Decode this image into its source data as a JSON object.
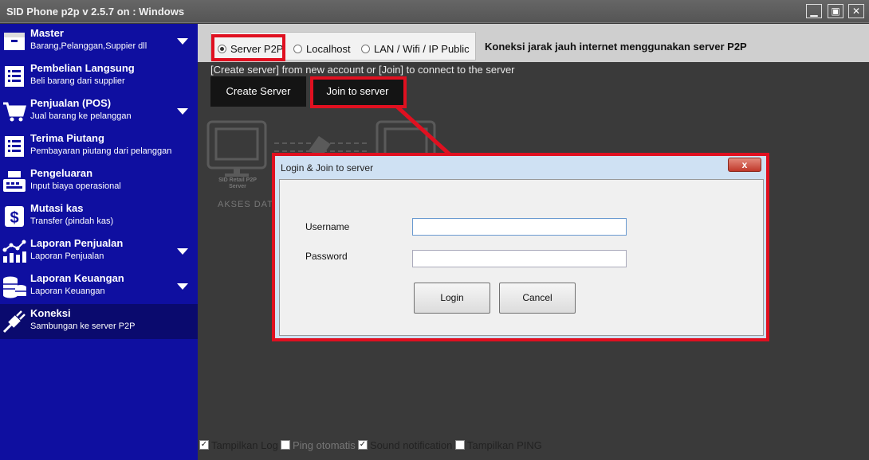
{
  "window": {
    "title": "SID Phone p2p v 2.5.7 on : Windows",
    "min_glyph": "▁",
    "max_glyph": "▣",
    "close_glyph": "✕"
  },
  "sidebar": {
    "items": [
      {
        "title": "Master",
        "subtitle": "Barang,Pelanggan,Suppier dll",
        "icon": "box-icon",
        "expandable": true
      },
      {
        "title": "Pembelian Langsung",
        "subtitle": "Beli barang dari supplier",
        "icon": "list-icon",
        "expandable": false
      },
      {
        "title": "Penjualan (POS)",
        "subtitle": "Jual barang ke pelanggan",
        "icon": "cart-icon",
        "expandable": true
      },
      {
        "title": "Terima Piutang",
        "subtitle": "Pembayaran piutang dari pelanggan",
        "icon": "list-icon",
        "expandable": false
      },
      {
        "title": "Pengeluaran",
        "subtitle": "Input biaya operasional",
        "icon": "cash-register-icon",
        "expandable": false
      },
      {
        "title": "Mutasi kas",
        "subtitle": "Transfer (pindah kas)",
        "icon": "dollar-icon",
        "expandable": false
      },
      {
        "title": "Laporan Penjualan",
        "subtitle": "Laporan Penjualan",
        "icon": "chart-icon",
        "expandable": true
      },
      {
        "title": "Laporan Keuangan",
        "subtitle": "Laporan Keuangan",
        "icon": "coins-icon",
        "expandable": true
      },
      {
        "title": "Koneksi",
        "subtitle": "Sambungan ke server P2P",
        "icon": "plug-icon",
        "expandable": false,
        "active": true
      }
    ]
  },
  "connection": {
    "options": [
      "Server P2P",
      "Localhost",
      "LAN / Wifi / IP Public"
    ],
    "selected": "Server P2P",
    "description": "Koneksi jarak jauh internet menggunakan server P2P",
    "instruction": "[Create server] from new account or [Join] to connect to the server",
    "create_label": "Create Server",
    "join_label": "Join to server"
  },
  "diagram": {
    "server_caption_1": "SID Retail P2P",
    "server_caption_2": "Server",
    "akses_label": "AKSES DATA"
  },
  "dialog": {
    "title": "Login & Join to server",
    "close_glyph": "x",
    "username_label": "Username",
    "username_value": "",
    "password_label": "Password",
    "password_value": "",
    "login_label": "Login",
    "cancel_label": "Cancel"
  },
  "footer": {
    "checks": [
      {
        "label": "Tampilkan Log",
        "checked": true
      },
      {
        "label": "Ping otomatis",
        "checked": false
      },
      {
        "label": "Sound notification",
        "checked": true
      },
      {
        "label": "Tampilkan PING",
        "checked": false
      }
    ]
  },
  "colors": {
    "sidebar": "#0f0fa0",
    "sidebar_active": "#0a0a6e",
    "highlight": "#e01020"
  }
}
